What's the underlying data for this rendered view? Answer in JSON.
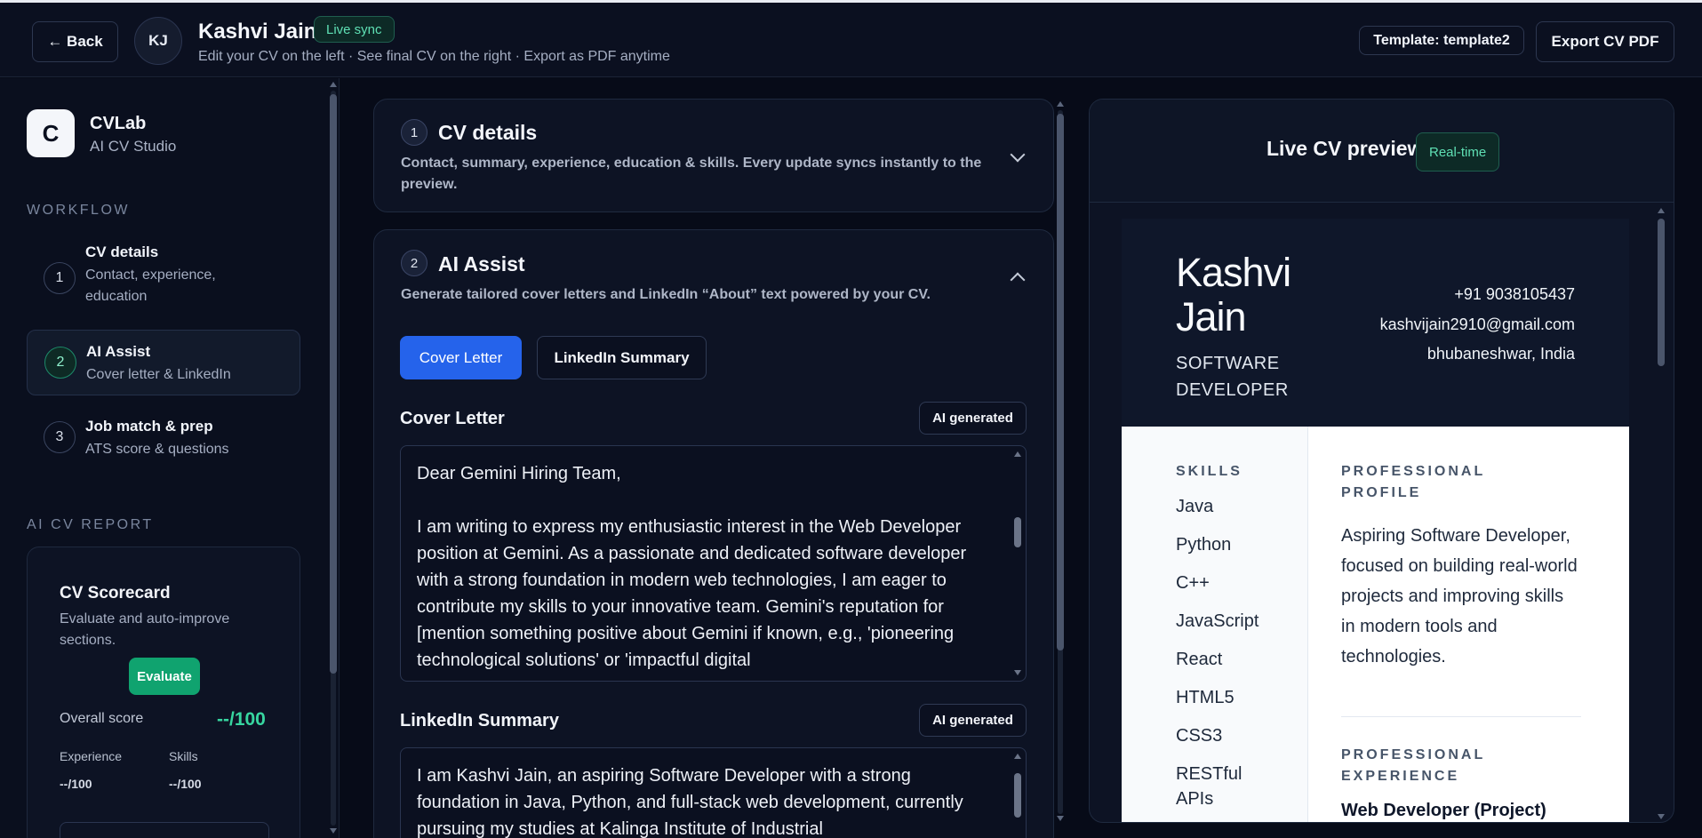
{
  "header": {
    "back_label": "← Back",
    "avatar_initials": "KJ",
    "user_name": "Kashvi Jain",
    "live_badge": "Live sync",
    "subtitle": "Edit your CV on the left · See final CV on the right · Export as PDF anytime",
    "template_label": "Template: template2",
    "export_label": "Export CV PDF"
  },
  "sidebar": {
    "logo_letter": "C",
    "brand_name": "CVLab",
    "brand_sub": "AI CV Studio",
    "workflow_label": "WORKFLOW",
    "items": [
      {
        "num": "1",
        "title": "CV details",
        "desc": "Contact, experience, education"
      },
      {
        "num": "2",
        "title": "AI Assist",
        "desc": "Cover letter & LinkedIn"
      },
      {
        "num": "3",
        "title": "Job match & prep",
        "desc": "ATS score & questions"
      }
    ],
    "report_label": "AI CV REPORT",
    "scorecard": {
      "title": "CV Scorecard",
      "desc": "Evaluate and auto-improve sections.",
      "evaluate_label": "Evaluate",
      "overall_label": "Overall score",
      "overall_value": "--/100",
      "experience_label": "Experience",
      "experience_value": "--/100",
      "skills_label": "Skills",
      "skills_value": "--/100"
    }
  },
  "editor": {
    "cv_details": {
      "num": "1",
      "title": "CV details",
      "desc": "Contact, summary, experience, education & skills. Every update syncs instantly to the preview."
    },
    "ai_assist": {
      "num": "2",
      "title": "AI Assist",
      "desc": "Generate tailored cover letters and LinkedIn “About” text powered by your CV.",
      "tab_cover": "Cover Letter",
      "tab_linkedin": "LinkedIn Summary",
      "cover_label": "Cover Letter",
      "cover_badge": "AI generated",
      "cover_text": "Dear Gemini Hiring Team,\n\nI am writing to express my enthusiastic interest in the Web Developer position at Gemini. As a passionate and dedicated software developer with a strong foundation in modern web technologies, I am eager to contribute my skills to your innovative team. Gemini's reputation for [mention something positive about Gemini if known, e.g., 'pioneering technological solutions' or 'impactful digital",
      "linkedin_label": "LinkedIn Summary",
      "linkedin_badge": "AI generated",
      "linkedin_text": "I am Kashvi Jain, an aspiring Software Developer with a strong foundation in Java, Python, and full-stack web development, currently pursuing my studies at Kalinga Institute of Industrial"
    }
  },
  "preview": {
    "title": "Live CV preview",
    "badge": "Real-time",
    "cv": {
      "name": "Kashvi Jain",
      "role": "SOFTWARE DEVELOPER",
      "phone": "+91 9038105437",
      "email": "kashvijain2910@gmail.com",
      "location": "bhubaneshwar, India",
      "skills_label": "SKILLS",
      "skills": [
        "Java",
        "Python",
        "C++",
        "JavaScript",
        "React",
        "HTML5",
        "CSS3",
        "RESTful APIs"
      ],
      "profile_label": "PROFESSIONAL PROFILE",
      "profile_text": "Aspiring Software Developer, focused on building real-world projects and improving skills in modern tools and technologies.",
      "experience_label": "PROFESSIONAL EXPERIENCE",
      "job_title": "Web Developer (Project)"
    }
  }
}
